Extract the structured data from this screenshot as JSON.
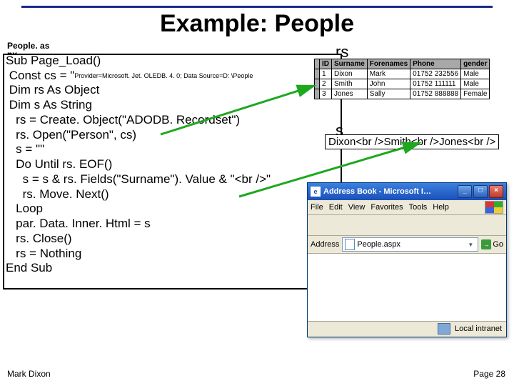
{
  "title": "Example: People",
  "filename": "People. as\npx",
  "rs_label": "rs",
  "s_label": "s",
  "s_value": "Dixon<br />Smith<br />Jones<br />",
  "code": {
    "sub": "Sub Page_Load()",
    "const_prefix": "Const cs = \"",
    "const_small": "Provider=Microsoft. Jet. OLEDB. 4. 0; Data Source=D: \\People",
    "dimrs": "Dim rs As Object",
    "dims": "Dim s As String",
    "create": "rs = Create. Object(\"ADODB. Recordset\")",
    "open": "rs. Open(\"Person\", cs)",
    "sinit": "s = \"\"",
    "do": "Do Until rs. EOF()",
    "concat": "s = s & rs. Fields(\"Surname\"). Value & \"<br />\"",
    "movenext": "rs. Move. Next()",
    "loop": "Loop",
    "par": "par. Data. Inner. Html = s",
    "close": "rs. Close()",
    "nothing": "rs = Nothing",
    "endsub": "End Sub"
  },
  "table": {
    "headers": [
      "",
      "ID",
      "Surname",
      "Forenames",
      "Phone",
      "gender"
    ],
    "rows": [
      [
        "",
        "1",
        "Dixon",
        "Mark",
        "01752 232556",
        "Male"
      ],
      [
        "",
        "2",
        "Smith",
        "John",
        "01752 111111",
        "Male"
      ],
      [
        "",
        "3",
        "Jones",
        "Sally",
        "01752 888888",
        "Female"
      ]
    ]
  },
  "browser": {
    "title": "Address Book - Microsoft I…",
    "menus": [
      "File",
      "Edit",
      "View",
      "Favorites",
      "Tools",
      "Help"
    ],
    "address_label": "Address",
    "address_value": "People.aspx",
    "go_label": "Go",
    "status": "Local intranet"
  },
  "footer": {
    "author": "Mark Dixon",
    "page": "Page 28"
  }
}
